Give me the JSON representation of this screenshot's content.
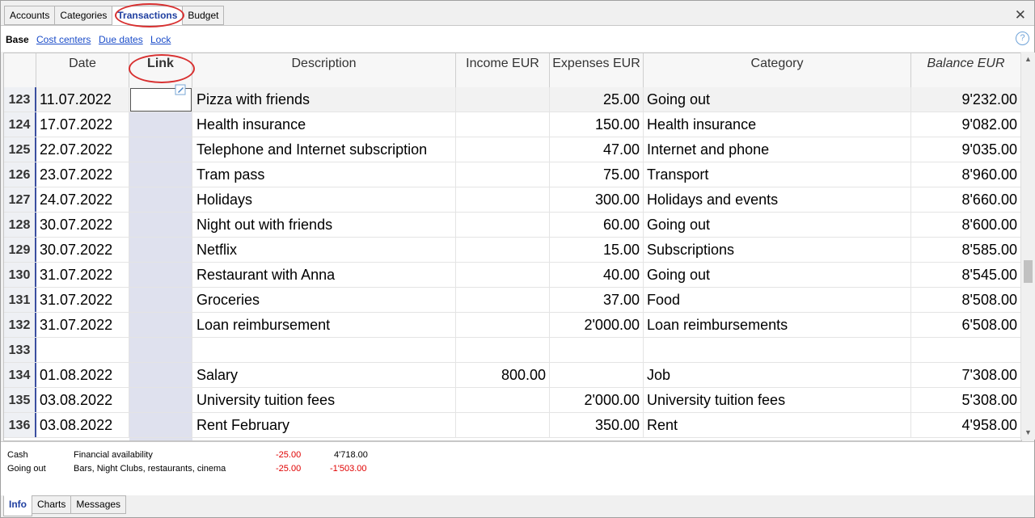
{
  "tabs": [
    "Accounts",
    "Categories",
    "Transactions",
    "Budget"
  ],
  "active_tab": "Transactions",
  "views": [
    "Base",
    "Cost centers",
    "Due dates",
    "Lock"
  ],
  "help_label": "?",
  "close_label": "✕",
  "columns": {
    "date": "Date",
    "link": "Link",
    "description": "Description",
    "income": "Income EUR",
    "expenses": "Expenses EUR",
    "category": "Category",
    "balance": "Balance EUR"
  },
  "rows": [
    {
      "num": "123",
      "date": "11.07.2022",
      "desc": "Pizza with friends",
      "income": "",
      "expenses": "25.00",
      "category": "Going out",
      "balance": "9'232.00"
    },
    {
      "num": "124",
      "date": "17.07.2022",
      "desc": "Health insurance",
      "income": "",
      "expenses": "150.00",
      "category": "Health insurance",
      "balance": "9'082.00"
    },
    {
      "num": "125",
      "date": "22.07.2022",
      "desc": "Telephone and Internet subscription",
      "income": "",
      "expenses": "47.00",
      "category": "Internet and phone",
      "balance": "9'035.00"
    },
    {
      "num": "126",
      "date": "23.07.2022",
      "desc": "Tram pass",
      "income": "",
      "expenses": "75.00",
      "category": "Transport",
      "balance": "8'960.00"
    },
    {
      "num": "127",
      "date": "24.07.2022",
      "desc": "Holidays",
      "income": "",
      "expenses": "300.00",
      "category": "Holidays and events",
      "balance": "8'660.00"
    },
    {
      "num": "128",
      "date": "30.07.2022",
      "desc": "Night out with friends",
      "income": "",
      "expenses": "60.00",
      "category": "Going out",
      "balance": "8'600.00"
    },
    {
      "num": "129",
      "date": "30.07.2022",
      "desc": "Netflix",
      "income": "",
      "expenses": "15.00",
      "category": "Subscriptions",
      "balance": "8'585.00"
    },
    {
      "num": "130",
      "date": "31.07.2022",
      "desc": "Restaurant with Anna",
      "income": "",
      "expenses": "40.00",
      "category": "Going out",
      "balance": "8'545.00"
    },
    {
      "num": "131",
      "date": "31.07.2022",
      "desc": "Groceries",
      "income": "",
      "expenses": "37.00",
      "category": "Food",
      "balance": "8'508.00"
    },
    {
      "num": "132",
      "date": "31.07.2022",
      "desc": "Loan reimbursement",
      "income": "",
      "expenses": "2'000.00",
      "category": "Loan reimbursements",
      "balance": "6'508.00"
    },
    {
      "num": "133",
      "date": "",
      "desc": "",
      "income": "",
      "expenses": "",
      "category": "",
      "balance": ""
    },
    {
      "num": "134",
      "date": "01.08.2022",
      "desc": "Salary",
      "income": "800.00",
      "expenses": "",
      "category": "Job",
      "balance": "7'308.00"
    },
    {
      "num": "135",
      "date": "03.08.2022",
      "desc": "University tuition fees",
      "income": "",
      "expenses": "2'000.00",
      "category": "University tuition fees",
      "balance": "5'308.00"
    },
    {
      "num": "136",
      "date": "03.08.2022",
      "desc": "Rent February",
      "income": "",
      "expenses": "350.00",
      "category": "Rent",
      "balance": "4'958.00"
    }
  ],
  "info": [
    {
      "account": "Cash",
      "description": "Financial availability",
      "amount": "-25.00",
      "balance": "4'718.00"
    },
    {
      "account": "Going out",
      "description": "Bars, Night Clubs, restaurants, cinema",
      "amount": "-25.00",
      "balance": "-1'503.00"
    }
  ],
  "bottom_tabs": [
    "Info",
    "Charts",
    "Messages"
  ],
  "active_bottom_tab": "Info",
  "colors": {
    "accent": "#1f3fa0",
    "annotation": "#d83030",
    "negative": "#e00000",
    "link": "#1a4cc9"
  }
}
